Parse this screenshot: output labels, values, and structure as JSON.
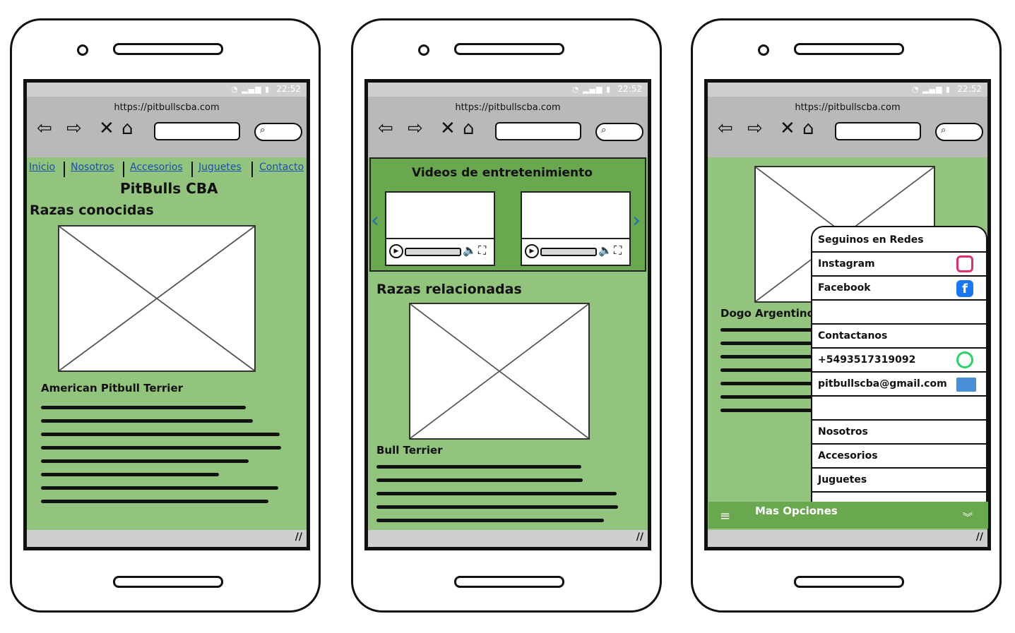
{
  "browser": {
    "url": "https://pitbullscba.com",
    "time": "22:52"
  },
  "phone1": {
    "menu": [
      "Inicio",
      "Nosotros",
      "Accesorios",
      "Juguetes",
      "Contacto"
    ],
    "site_title": "PitBulls CBA",
    "section_title": "Razas conocidas",
    "breed_name": "American Pitbull Terrier"
  },
  "phone2": {
    "videos_title": "Videos de entretenimiento",
    "section_title": "Razas relacionadas",
    "breed_name": "Bull Terrier"
  },
  "phone3": {
    "breed_name": "Dogo Argentino",
    "popup": {
      "social_header": "Seguinos en Redes",
      "instagram": "Instagram",
      "facebook": "Facebook",
      "contact_header": "Contactanos",
      "phone": "+5493517319092",
      "email": "pitbullscba@gmail.com",
      "links": [
        "Nosotros",
        "Accesorios",
        "Juguetes"
      ]
    },
    "more_options": "Mas Opciones"
  },
  "colors": {
    "page_bg": "#92c47d",
    "accent_green": "#6aa84f",
    "link_blue": "#1a4fb0",
    "instagram": "#e1306c",
    "facebook": "#1877f2",
    "whatsapp": "#25d366",
    "email": "#4a90d9"
  }
}
